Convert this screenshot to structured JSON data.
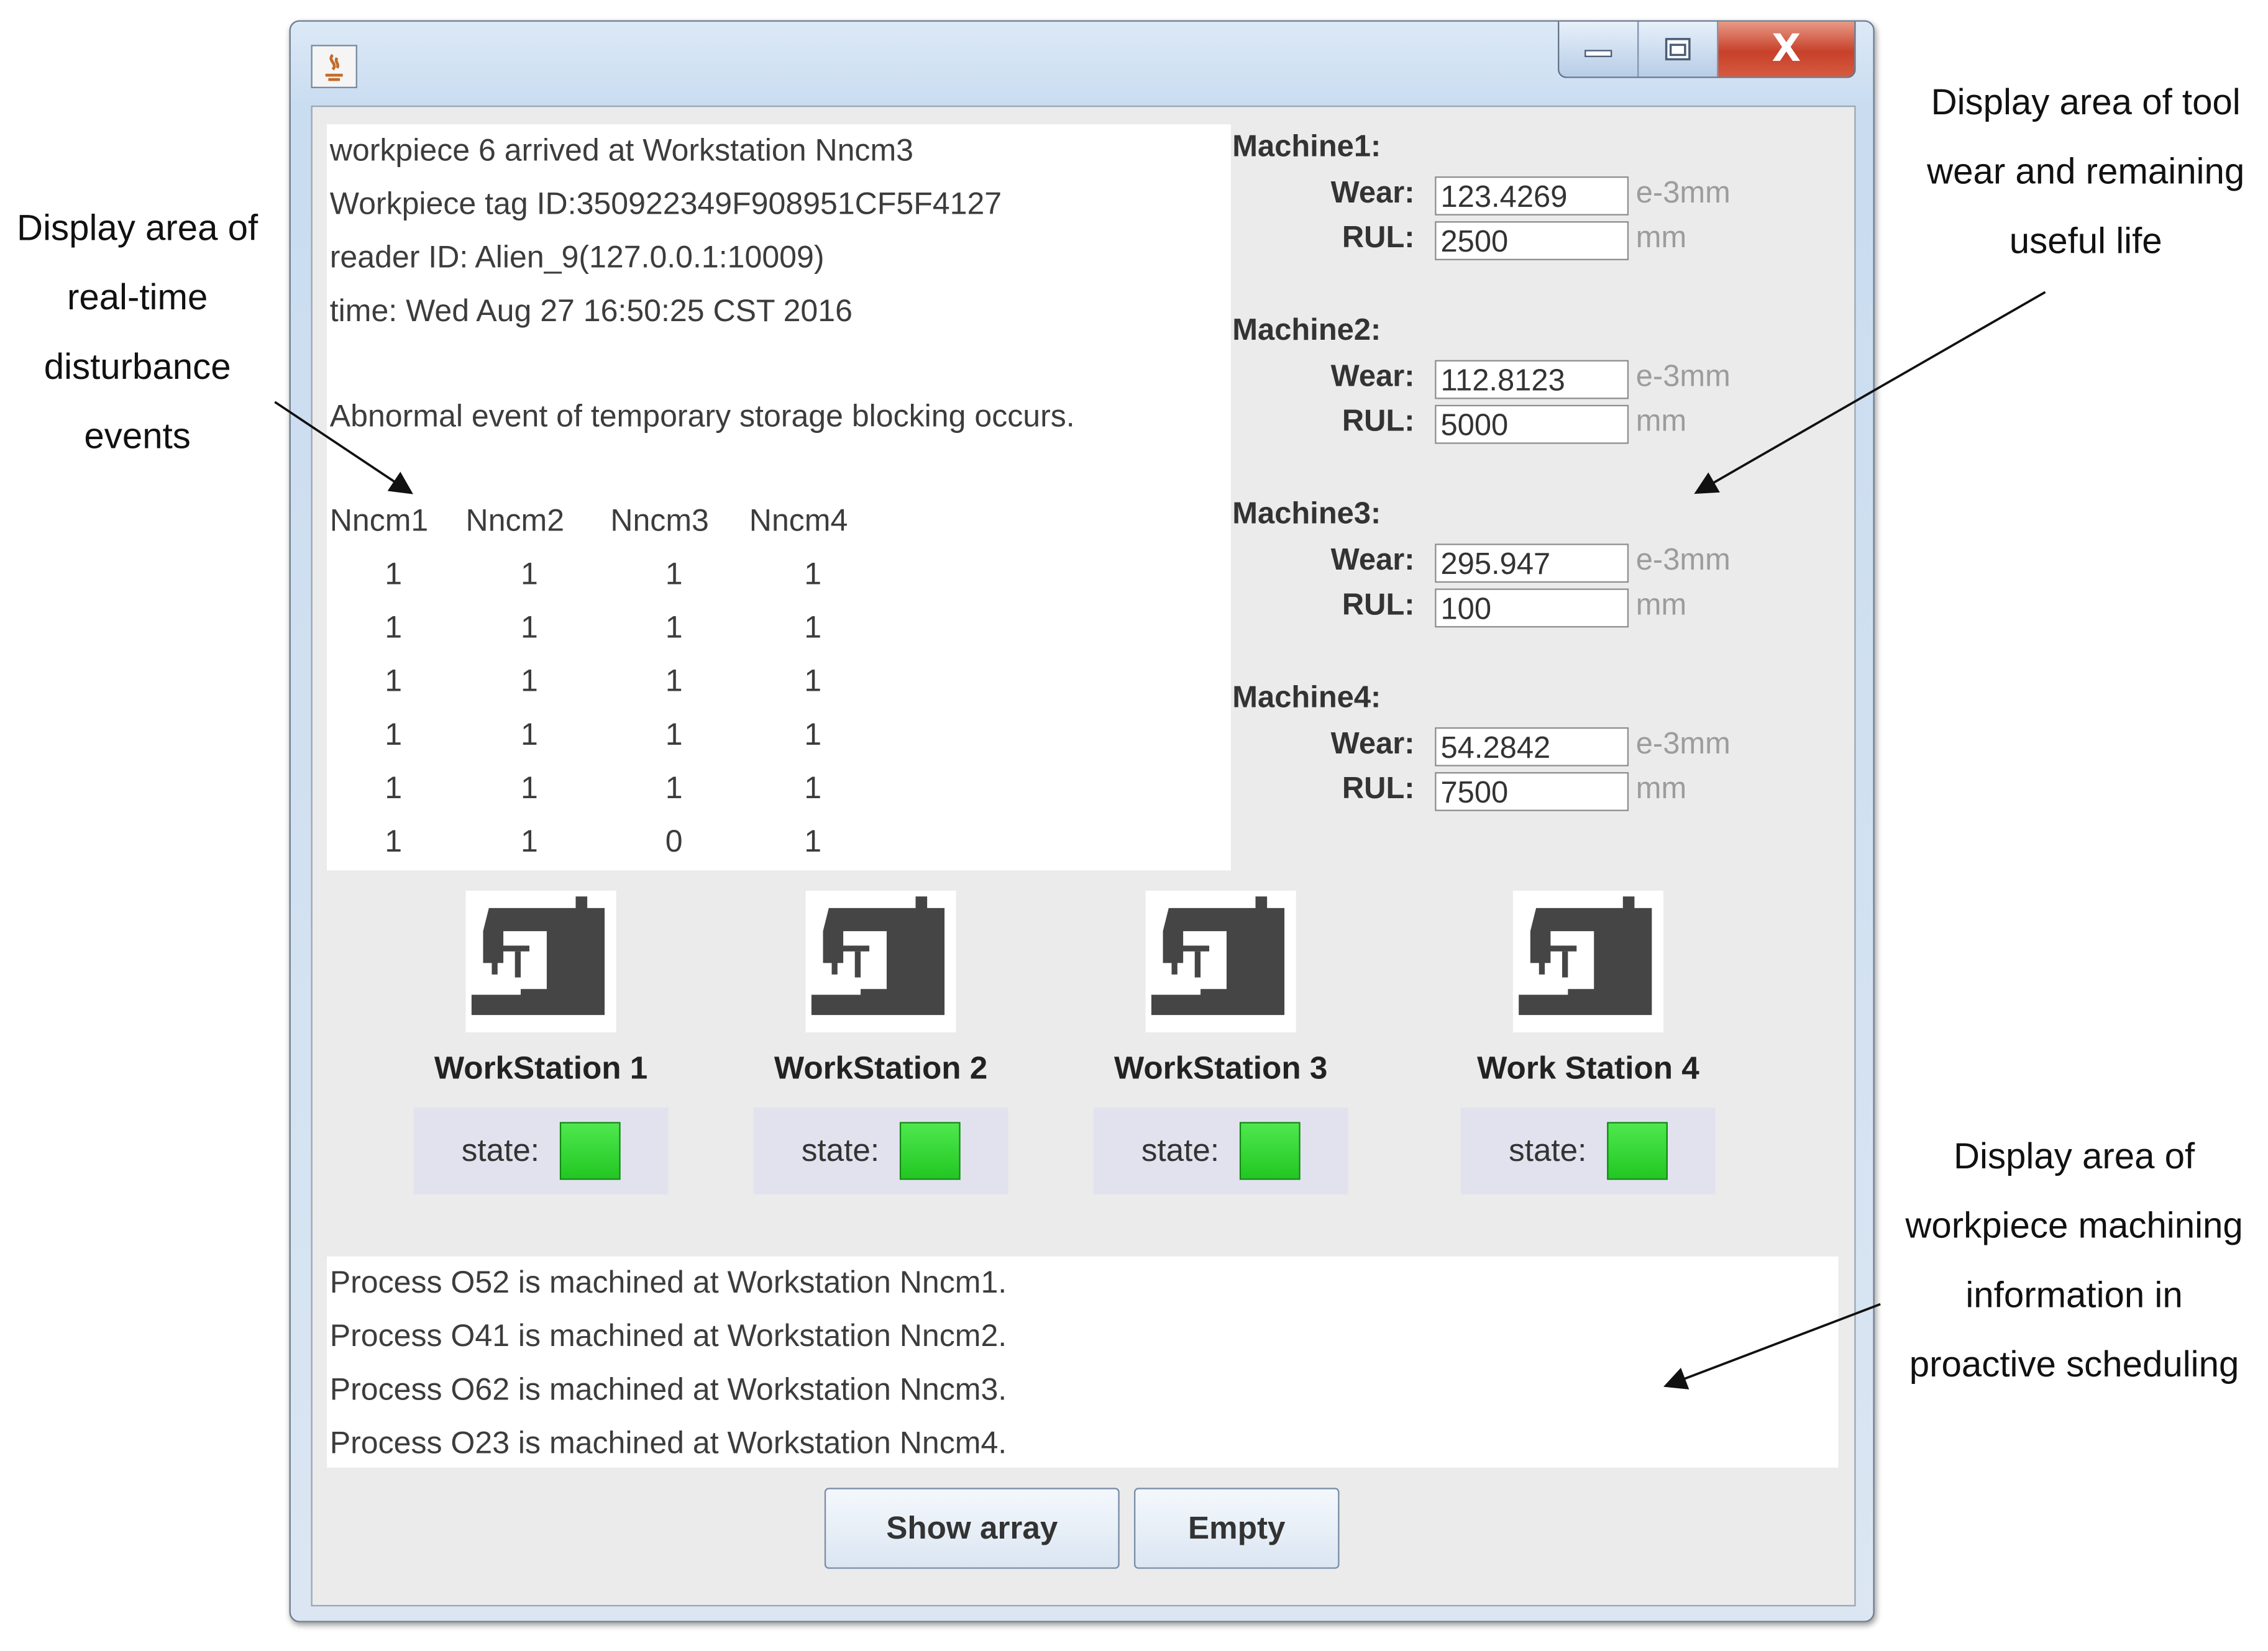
{
  "annotations": {
    "left": [
      "Display area of",
      "real-time",
      "disturbance",
      "events"
    ],
    "right_top": [
      "Display area of tool",
      "wear and remaining",
      "useful life"
    ],
    "right_bottom": [
      "Display area of",
      "workpiece machining",
      "information in",
      "proactive scheduling"
    ]
  },
  "window": {
    "controls": {
      "minimize": "minimize-icon",
      "maximize": "maximize-icon",
      "close_label": "X"
    }
  },
  "event_log": {
    "lines": [
      "workpiece 6 arrived at Workstation Nncm3",
      "Workpiece tag ID:350922349F908951CF5F4127",
      "reader ID: Alien_9(127.0.0.1:10009)",
      "time: Wed Aug 27 16:50:25 CST 2016"
    ],
    "abnormal": "Abnormal event of temporary storage blocking occurs.",
    "table": {
      "headers": [
        "Nncm1",
        "Nncm2",
        "Nncm3",
        "Nncm4"
      ],
      "rows": [
        [
          "1",
          "1",
          "1",
          "1"
        ],
        [
          "1",
          "1",
          "1",
          "1"
        ],
        [
          "1",
          "1",
          "1",
          "1"
        ],
        [
          "1",
          "1",
          "1",
          "1"
        ],
        [
          "1",
          "1",
          "1",
          "1"
        ],
        [
          "1",
          "1",
          "0",
          "1"
        ]
      ]
    }
  },
  "machines": [
    {
      "name": "Machine1:",
      "wear_label": "Wear:",
      "wear": "123.4269",
      "wear_unit": "e-3mm",
      "rul_label": "RUL:",
      "rul": "2500",
      "rul_unit": "mm"
    },
    {
      "name": "Machine2:",
      "wear_label": "Wear:",
      "wear": "112.8123",
      "wear_unit": "e-3mm",
      "rul_label": "RUL:",
      "rul": "5000",
      "rul_unit": "mm"
    },
    {
      "name": "Machine3:",
      "wear_label": "Wear:",
      "wear": "295.947",
      "wear_unit": "e-3mm",
      "rul_label": "RUL:",
      "rul": "100",
      "rul_unit": "mm"
    },
    {
      "name": "Machine4:",
      "wear_label": "Wear:",
      "wear": "54.2842",
      "wear_unit": "e-3mm",
      "rul_label": "RUL:",
      "rul": "7500",
      "rul_unit": "mm"
    }
  ],
  "workstations": [
    {
      "name": "WorkStation 1",
      "state_label": "state:",
      "icon": "sewing-machine-icon",
      "state_color": "#22c722"
    },
    {
      "name": "WorkStation 2",
      "state_label": "state:",
      "icon": "sewing-machine-icon",
      "state_color": "#22c722"
    },
    {
      "name": "WorkStation 3",
      "state_label": "state:",
      "icon": "sewing-machine-icon",
      "state_color": "#22c722"
    },
    {
      "name": "Work Station 4",
      "state_label": "state:",
      "icon": "sewing-machine-icon",
      "state_color": "#22c722"
    }
  ],
  "process_log": [
    "Process O52 is machined at Workstation Nncm1.",
    "Process O41 is machined at Workstation Nncm2.",
    "Process O62 is machined at Workstation Nncm3.",
    "Process O23 is machined at Workstation Nncm4."
  ],
  "buttons": {
    "show_array": "Show array",
    "empty": "Empty"
  }
}
